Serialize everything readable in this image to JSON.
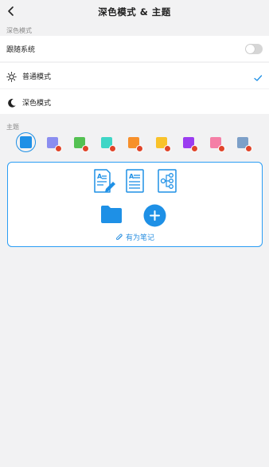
{
  "header": {
    "title": "深色模式 & 主题",
    "back_icon": "chevron-left-icon"
  },
  "dark_mode_section": {
    "label": "深色模式",
    "follow_system": {
      "label": "跟随系统",
      "enabled": false
    },
    "options": [
      {
        "label": "普通模式",
        "icon": "sun-icon",
        "selected": true
      },
      {
        "label": "深色模式",
        "icon": "moon-icon",
        "selected": false
      }
    ]
  },
  "theme_section": {
    "label": "主题",
    "swatches": [
      {
        "color": "#1e90e6",
        "selected": true,
        "locked": false
      },
      {
        "color": "#8b8ef0",
        "selected": false,
        "locked": true
      },
      {
        "color": "#54c152",
        "selected": false,
        "locked": true
      },
      {
        "color": "#3fd6c6",
        "selected": false,
        "locked": true
      },
      {
        "color": "#f7902b",
        "selected": false,
        "locked": true
      },
      {
        "color": "#f9c22a",
        "selected": false,
        "locked": true
      },
      {
        "color": "#9b3df0",
        "selected": false,
        "locked": true
      },
      {
        "color": "#f57fa6",
        "selected": false,
        "locked": true
      },
      {
        "color": "#7da0c8",
        "selected": false,
        "locked": true
      }
    ]
  },
  "preview": {
    "icons": [
      "document-edit-icon",
      "document-text-icon",
      "mindmap-icon",
      "folder-icon",
      "add-icon"
    ],
    "brand_icon": "paperclip-icon",
    "brand_label": "有为笔记"
  },
  "colors": {
    "accent": "#1e90e6",
    "background": "#f2f2f3"
  }
}
